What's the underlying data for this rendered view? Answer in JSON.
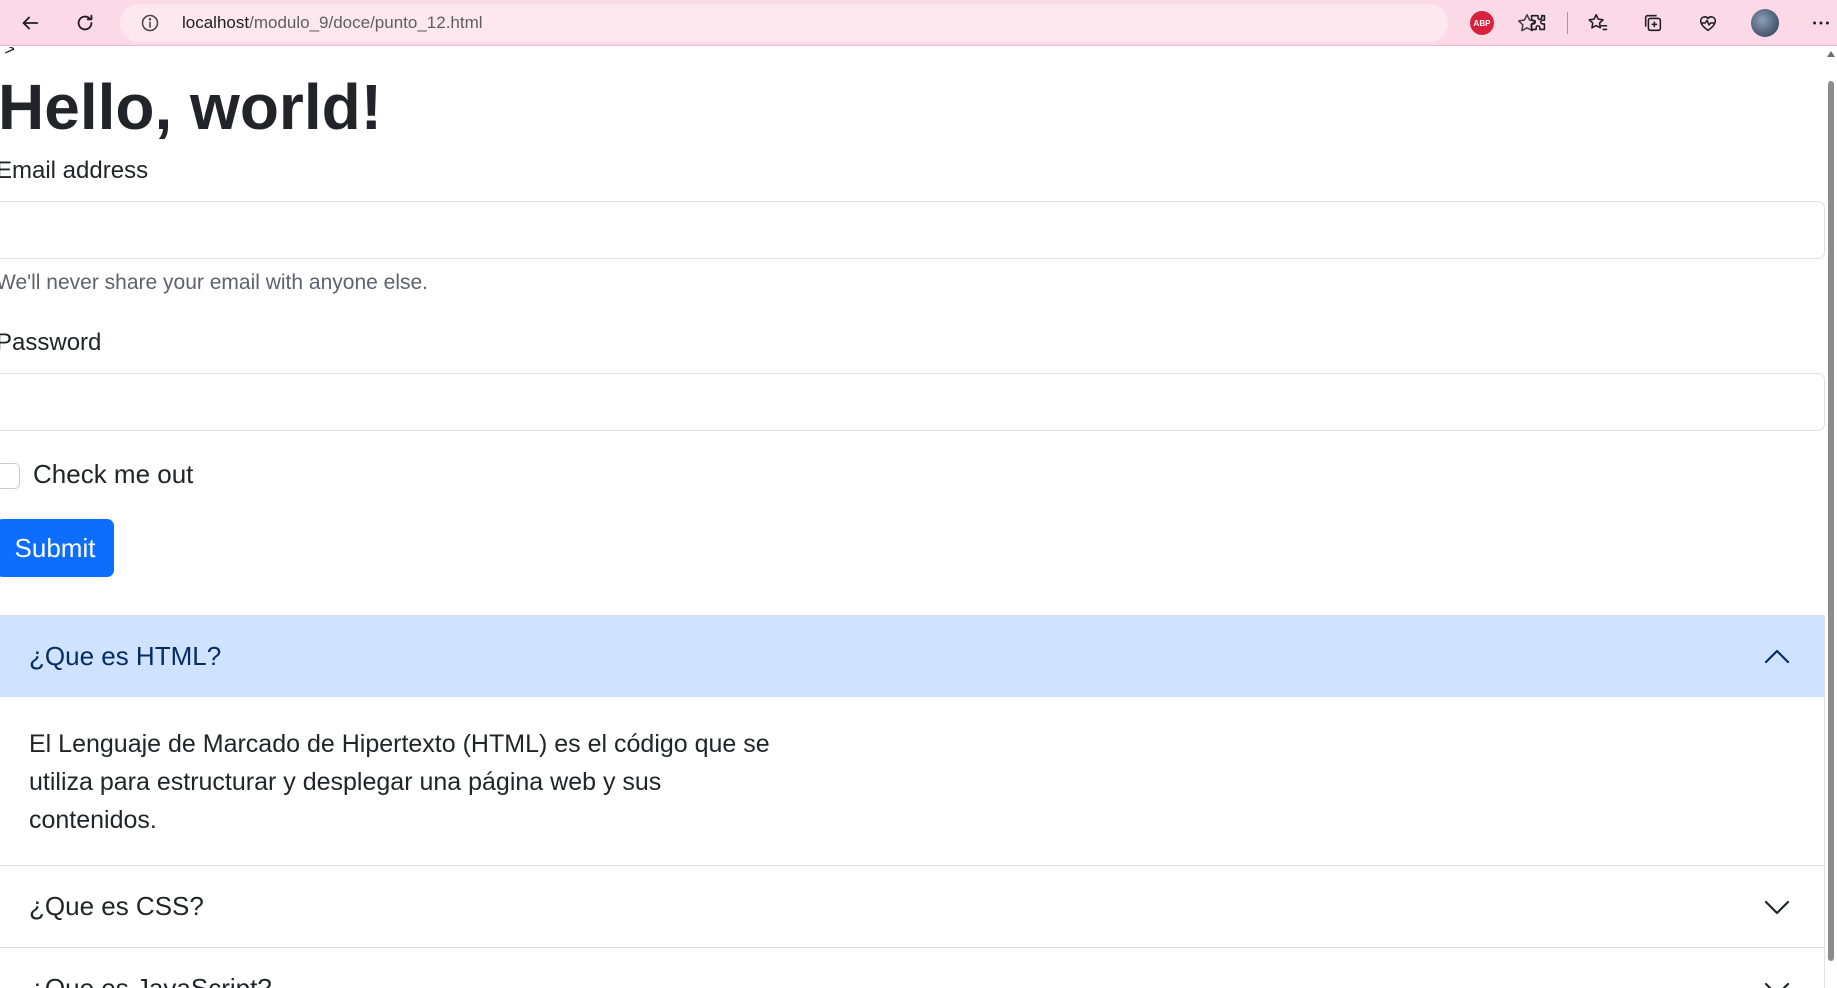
{
  "browser": {
    "url_host": "localhost",
    "url_path": "/modulo_9/doce/punto_12.html",
    "extension_badge": "ABP"
  },
  "page": {
    "stray_text": "\">",
    "title": "Hello, world!",
    "form": {
      "email_label": "Email address",
      "email_value": "",
      "email_help": "We'll never share your email with anyone else.",
      "password_label": "Password",
      "password_value": "",
      "checkbox_label": "Check me out",
      "checkbox_checked": false,
      "submit_label": "Submit"
    },
    "accordion": [
      {
        "header": "¿Que es HTML?",
        "expanded": true,
        "body": "El Lenguaje de Marcado de Hipertexto (HTML) es el código que se utiliza para estructurar y desplegar una página web y sus contenidos."
      },
      {
        "header": "¿Que es CSS?",
        "expanded": false
      },
      {
        "header": "¿Que es JavaScript?",
        "expanded": false
      }
    ]
  },
  "colors": {
    "toolbar": "#fcd9e6",
    "primary": "#0d6efd",
    "accordion_open_bg": "#cfe2ff"
  }
}
